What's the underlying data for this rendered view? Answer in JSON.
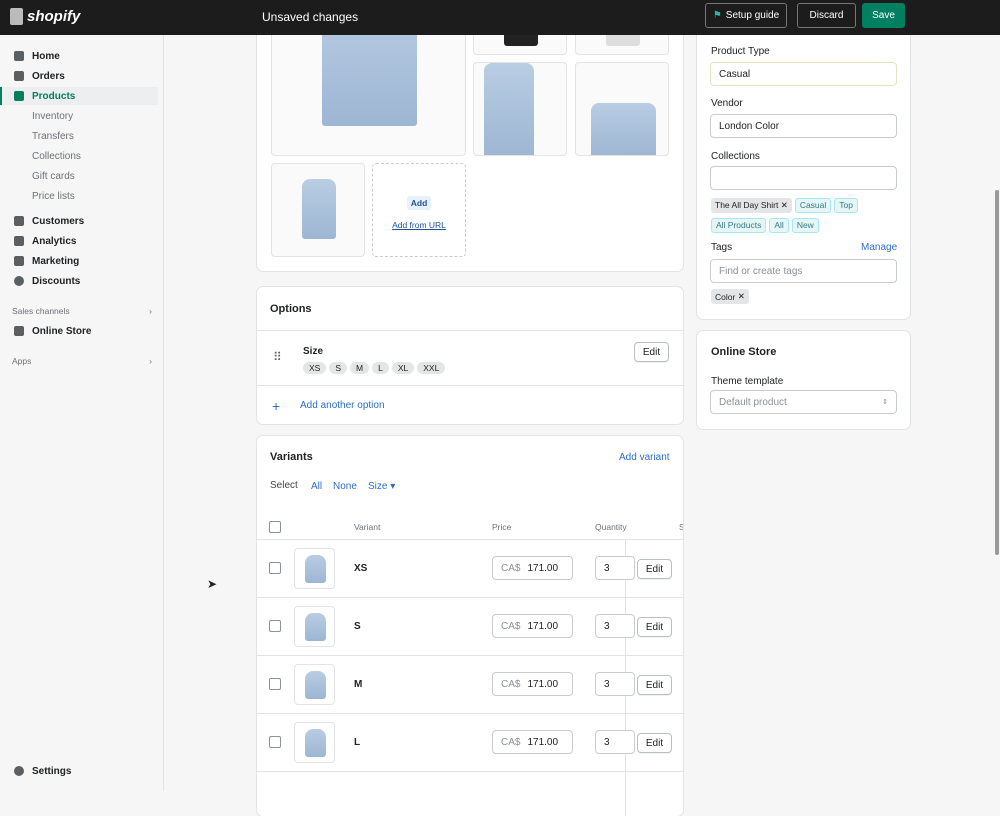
{
  "topbar": {
    "brand": "shopify",
    "title": "Unsaved changes",
    "setup_guide": "Setup guide",
    "discard": "Discard",
    "save": "Save"
  },
  "colors": {
    "accent": "#008060",
    "topbar": "#1c1c1c",
    "link": "#2c6ecb"
  },
  "sidebar": {
    "items": [
      {
        "label": "Home",
        "icon": "home-icon"
      },
      {
        "label": "Orders",
        "icon": "inbox-icon"
      },
      {
        "label": "Products",
        "icon": "tag-icon"
      },
      {
        "label": "Customers",
        "icon": "person-icon"
      },
      {
        "label": "Analytics",
        "icon": "bar-chart-icon"
      },
      {
        "label": "Marketing",
        "icon": "target-icon"
      },
      {
        "label": "Discounts",
        "icon": "discount-icon"
      }
    ],
    "product_subitems": [
      "Inventory",
      "Transfers",
      "Collections",
      "Gift cards",
      "Price lists"
    ],
    "sales_channels": "Sales channels",
    "online_store": "Online Store",
    "apps": "Apps",
    "settings": "Settings"
  },
  "media": {
    "add": "Add",
    "add_from_url": "Add from URL"
  },
  "options": {
    "title": "Options",
    "option_name": "Size",
    "values": [
      "XS",
      "S",
      "M",
      "L",
      "XL",
      "XXL"
    ],
    "edit": "Edit",
    "add_another": "Add another option"
  },
  "variants": {
    "title": "Variants",
    "add_variant": "Add variant",
    "select": "Select",
    "all": "All",
    "none": "None",
    "size": "Size",
    "headers": {
      "variant": "Variant",
      "price": "Price",
      "quantity": "Quantity",
      "sku": "SKU"
    },
    "rows": [
      {
        "name": "XS",
        "currency": "CA$",
        "price": "171.00",
        "qty": "3",
        "edit": "Edit"
      },
      {
        "name": "S",
        "currency": "CA$",
        "price": "171.00",
        "qty": "3",
        "edit": "Edit"
      },
      {
        "name": "M",
        "currency": "CA$",
        "price": "171.00",
        "qty": "3",
        "edit": "Edit"
      },
      {
        "name": "L",
        "currency": "CA$",
        "price": "171.00",
        "qty": "3",
        "edit": "Edit"
      }
    ]
  },
  "organization": {
    "product_type_label": "Product Type",
    "product_type": "Casual",
    "vendor_label": "Vendor",
    "vendor": "London Color",
    "collections_label": "Collections",
    "collection_selected": "The All Day Shirt",
    "collection_suggestions": [
      "Casual",
      "Top",
      "All Products",
      "All",
      "New"
    ],
    "tags_label": "Tags",
    "manage": "Manage",
    "tags_placeholder": "Find or create tags",
    "tags": [
      "Color"
    ]
  },
  "online_store": {
    "title": "Online Store",
    "theme_label": "Theme template",
    "theme_value": "Default product"
  }
}
